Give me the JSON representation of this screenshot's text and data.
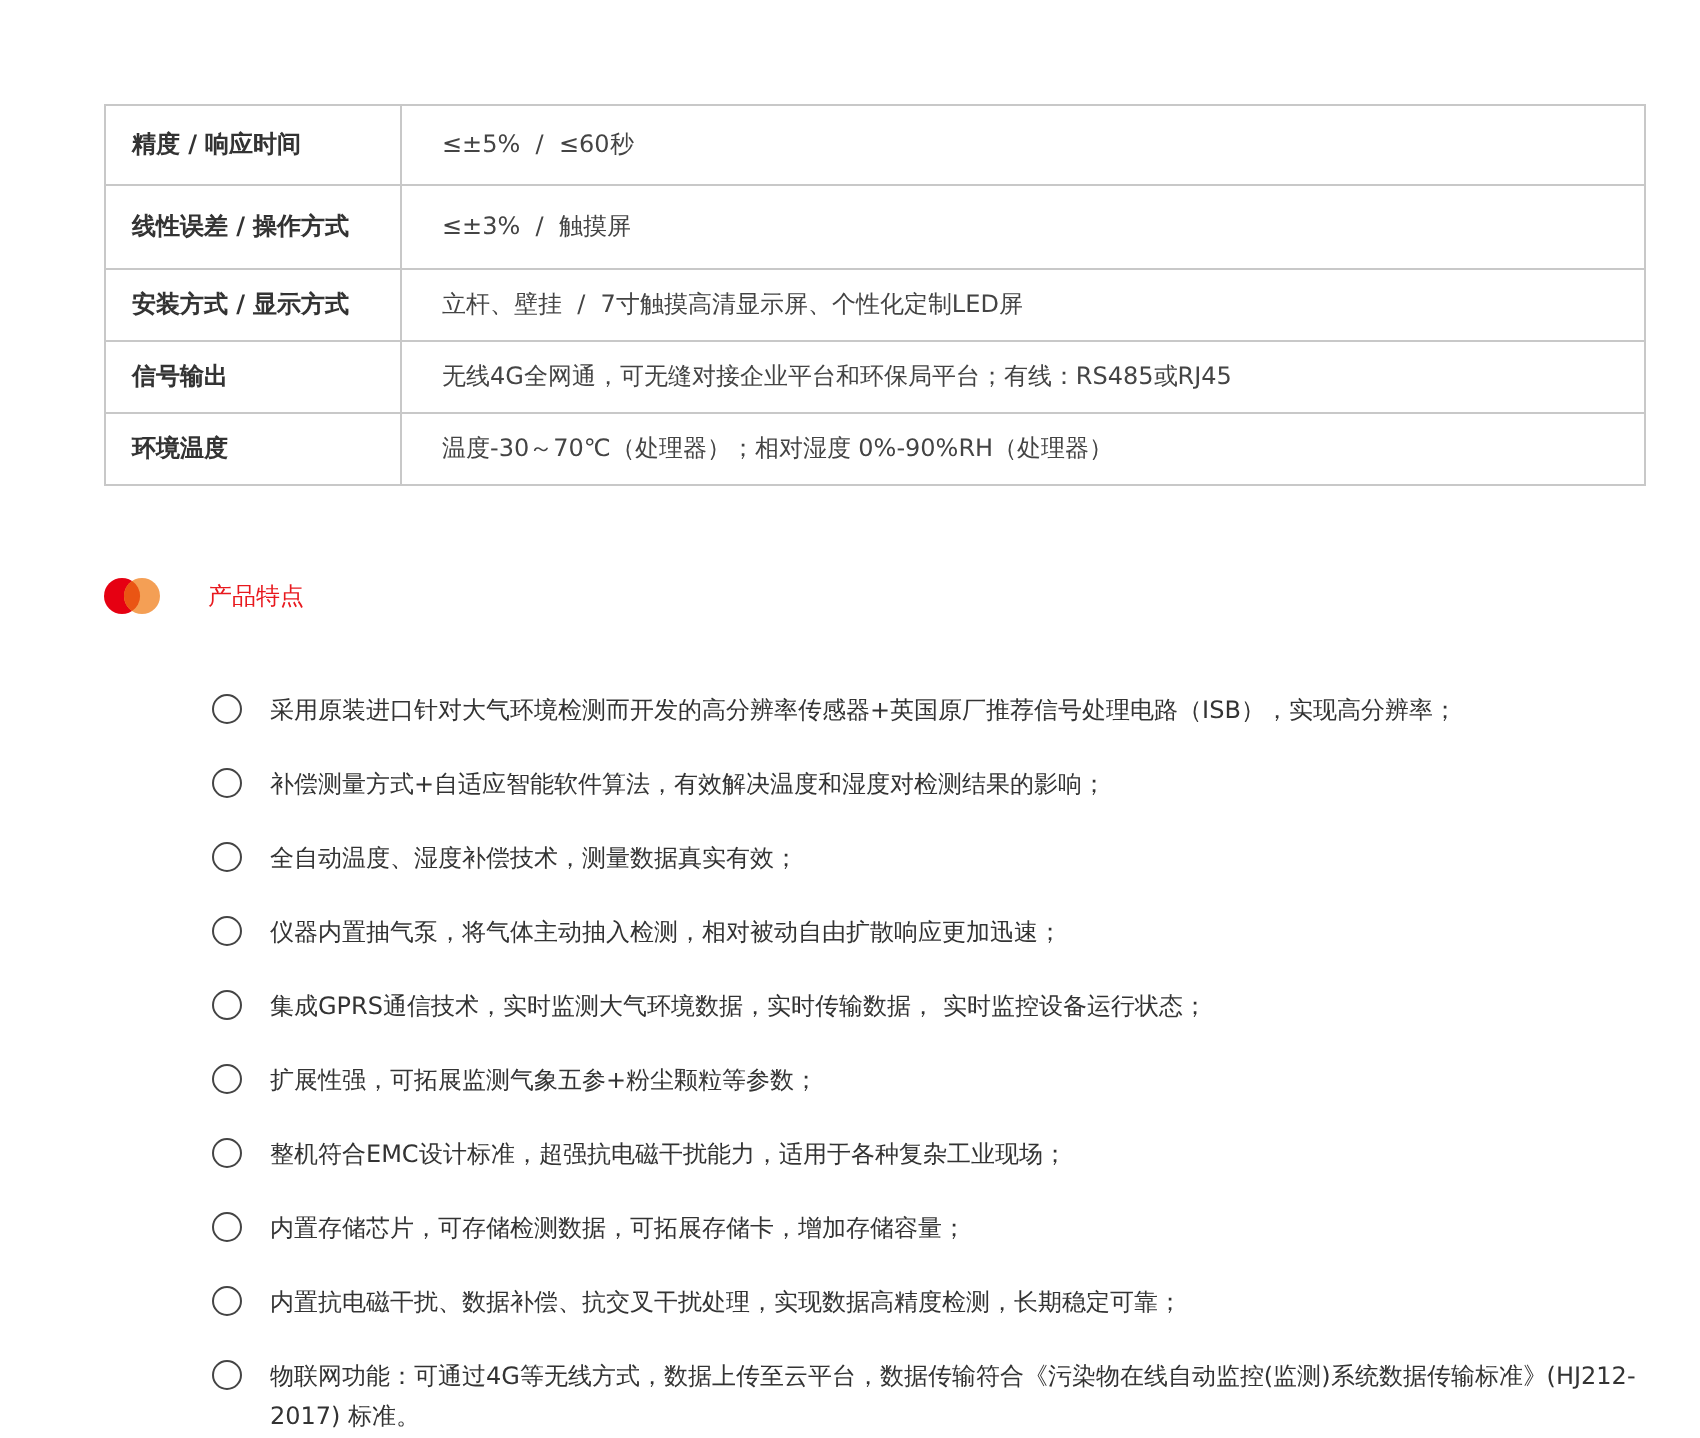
{
  "spec_table": {
    "rows": [
      {
        "label": "精度 / 响应时间",
        "value": "≤±5%  /  ≤60秒"
      },
      {
        "label": "线性误差 / 操作方式",
        "value": "≤±3%  /  触摸屏"
      },
      {
        "label": "安装方式 / 显示方式",
        "value": "立杆、壁挂  /  7寸触摸高清显示屏、个性化定制LED屏"
      },
      {
        "label": "信号输出",
        "value": "无线4G全网通，可无缝对接企业平台和环保局平台；有线：RS485或RJ45"
      },
      {
        "label": "环境温度",
        "value": "温度-30～70℃（处理器）；相对湿度 0%-90%RH（处理器）"
      }
    ]
  },
  "features": {
    "title": "产品特点",
    "items": [
      "采用原装进口针对大气环境检测而开发的高分辨率传感器+英国原厂推荐信号处理电路（ISB），实现高分辨率；",
      "补偿测量方式+自适应智能软件算法，有效解决温度和湿度对检测结果的影响；",
      "全自动温度、湿度补偿技术，测量数据真实有效；",
      "仪器内置抽气泵，将气体主动抽入检测，相对被动自由扩散响应更加迅速；",
      "集成GPRS通信技术，实时监测大气环境数据，实时传输数据， 实时监控设备运行状态；",
      "扩展性强，可拓展监测气象五参+粉尘颗粒等参数；",
      "整机符合EMC设计标准，超强抗电磁干扰能力，适用于各种复杂工业现场；",
      "内置存储芯片，可存储检测数据，可拓展存储卡，增加存储容量；",
      "内置抗电磁干扰、数据补偿、抗交叉干扰处理，实现数据高精度检测，长期稳定可靠；",
      "物联网功能：可通过4G等无线方式，数据上传至云平台，数据传输符合《污染物在线自动监控(监测)系统数据传输标准》(HJ212-2017) 标准。"
    ]
  }
}
